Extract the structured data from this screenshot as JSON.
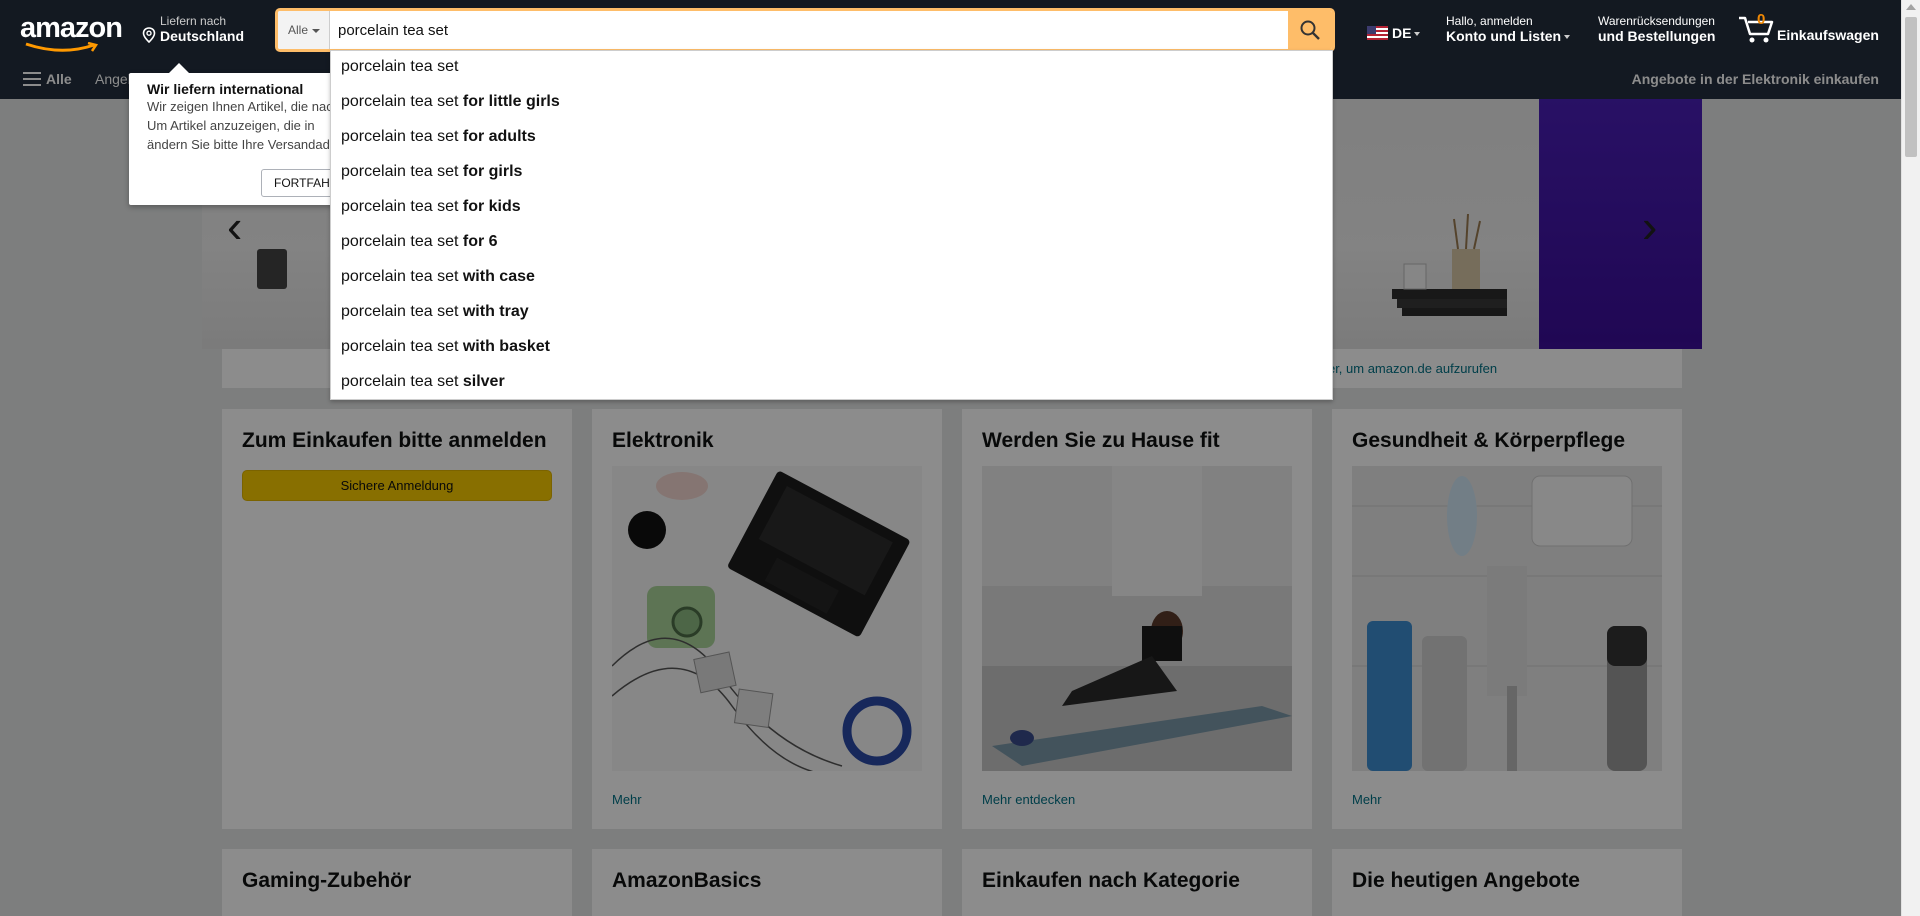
{
  "header": {
    "logo_text": "amazon",
    "deliver_line1": "Liefern nach",
    "deliver_line2": "Deutschland",
    "search_category": "Alle",
    "search_value": "porcelain tea set",
    "language": "DE",
    "account_line1": "Hallo, anmelden",
    "account_line2": "Konto und Listen",
    "returns_line1": "Warenrücksendungen",
    "returns_line2": "und Bestellungen",
    "cart_count": "0",
    "cart_label": "Einkaufswagen"
  },
  "subnav": {
    "all_label": "Alle",
    "link1": "Angebote",
    "promo": "Angebote in der Elektronik einkaufen"
  },
  "popover": {
    "title": "Wir liefern international",
    "line1": "Wir zeigen Ihnen Artikel, die nach",
    "line2": "Um Artikel anzuzeigen, die in",
    "line3": "ändern Sie bitte Ihre Versandadresse.",
    "button": "FORTFAHREN"
  },
  "suggestions": [
    {
      "prefix": "porcelain tea set",
      "suffix": ""
    },
    {
      "prefix": "porcelain tea set ",
      "suffix": "for little girls"
    },
    {
      "prefix": "porcelain tea set ",
      "suffix": "for adults"
    },
    {
      "prefix": "porcelain tea set ",
      "suffix": "for girls"
    },
    {
      "prefix": "porcelain tea set ",
      "suffix": "for kids"
    },
    {
      "prefix": "porcelain tea set ",
      "suffix": "for 6"
    },
    {
      "prefix": "porcelain tea set ",
      "suffix": "with case"
    },
    {
      "prefix": "porcelain tea set ",
      "suffix": "with tray"
    },
    {
      "prefix": "porcelain tea set ",
      "suffix": "with basket"
    },
    {
      "prefix": "porcelain tea set ",
      "suffix": "silver"
    }
  ],
  "notice_bar": "e hier, um amazon.de aufzurufen",
  "cards": [
    {
      "title": "Zum Einkaufen bitte anmelden",
      "button": "Sichere Anmeldung"
    },
    {
      "title": "Elektronik",
      "more": "Mehr"
    },
    {
      "title": "Werden Sie zu Hause fit",
      "more": "Mehr entdecken"
    },
    {
      "title": "Gesundheit & Körperpflege",
      "more": "Mehr"
    },
    {
      "title": "Gaming-Zubehör"
    },
    {
      "title": "AmazonBasics"
    },
    {
      "title": "Einkaufen nach Kategorie"
    },
    {
      "title": "Die heutigen Angebote"
    }
  ],
  "colors": {
    "nav_bg": "#131921",
    "subnav_bg": "#232f3e",
    "search_accent": "#febd69",
    "signin_button": "#f7ca00",
    "link": "#007185"
  }
}
